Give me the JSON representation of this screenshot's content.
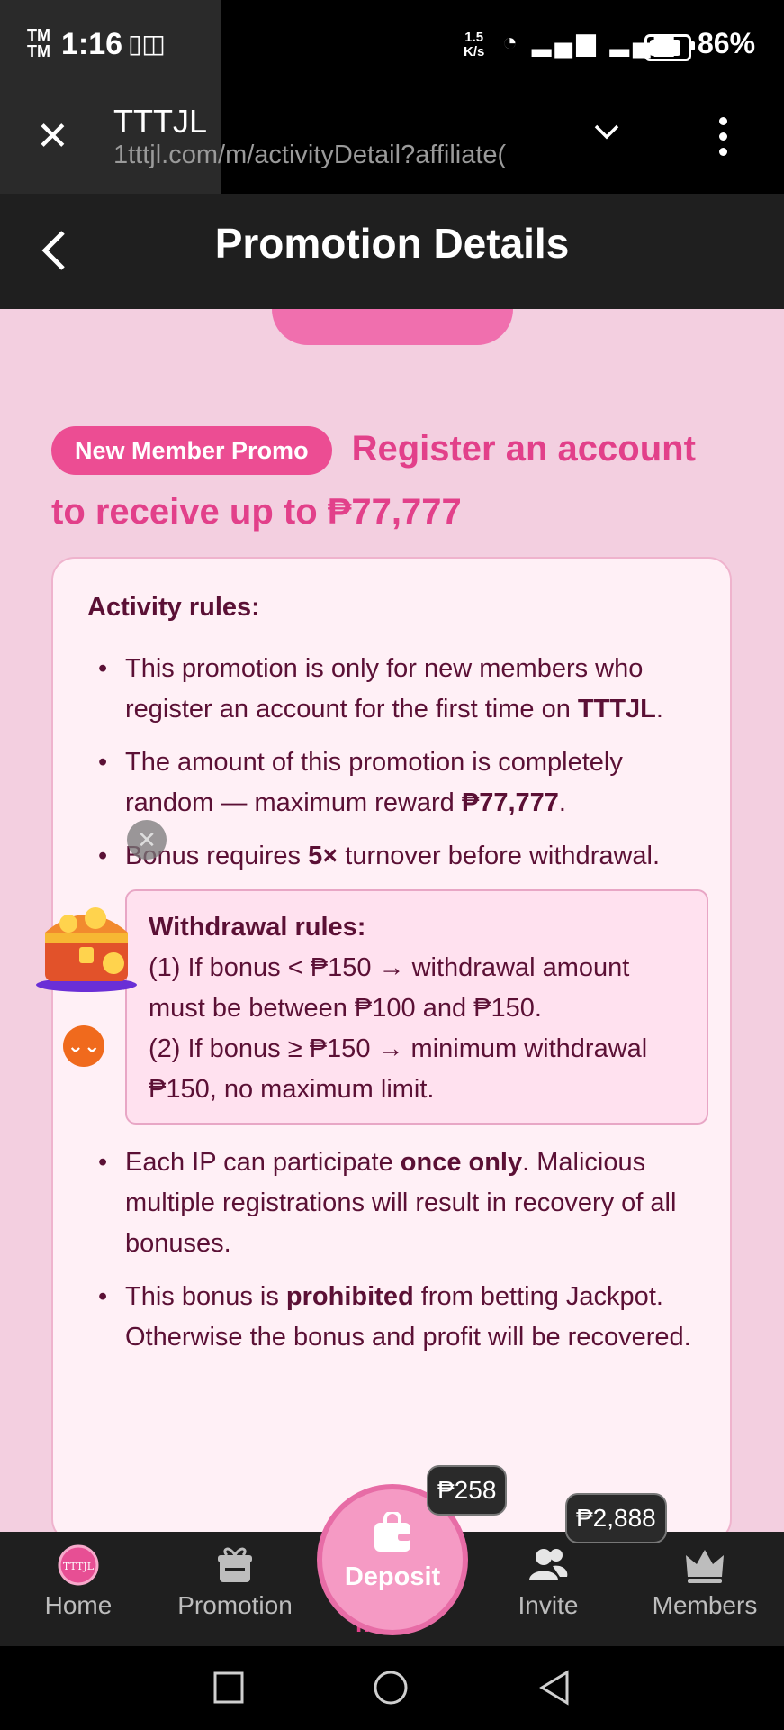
{
  "status_bar": {
    "carrier_mark": "TM\nTM",
    "time": "1:16",
    "net_speed": "1.5\nK/s",
    "battery": "86%"
  },
  "browser": {
    "title": "TTTJL",
    "url": "1tttjl.com/m/activityDetail?affiliate("
  },
  "header": {
    "title": "Promotion Details"
  },
  "promo": {
    "badge": "New Member Promo",
    "headline": "Register an account to receive up to ₱77,777"
  },
  "rules_card": {
    "title": "Activity rules:",
    "rule1": {
      "a": "This promotion is only for new members who register an account for the first time on ",
      "b": "TTTJL",
      "c": "."
    },
    "rule2": {
      "a": "The amount of this promotion is completely random — maximum reward ",
      "b": "₱77,777",
      "c": "."
    },
    "rule3": {
      "a": "Bonus requires ",
      "b": "5×",
      "c": " turnover before withdrawal."
    },
    "withdrawal": {
      "title": "Withdrawal rules:",
      "line1": "(1) If bonus < ₱150 → withdrawal amount must be between ₱100 and ₱150.",
      "line2": "(2) If bonus ≥ ₱150 → minimum withdrawal ₱150, no maximum limit."
    },
    "rule4": {
      "a": "Each IP can participate ",
      "b": "once only",
      "c": ". Malicious multiple registrations will result in recovery of all bonuses."
    },
    "rule5": {
      "a": "This bonus is ",
      "b": "prohibited",
      "c": " from betting Jackpot. Otherwise the bonus and profit will be recovered."
    }
  },
  "bottom_nav": {
    "home": "Home",
    "promotion": "Promotion",
    "deposit": "Deposit",
    "invite": "Invite",
    "members": "Members",
    "deposit_bubble": "₱258",
    "invite_bubble": "₱2,888",
    "ghost_label": "nus"
  },
  "icons": {
    "close": "close-icon",
    "chevron_down": "chevron-down-icon",
    "more": "more-vertical-icon",
    "back": "back-chevron-icon"
  },
  "colors": {
    "accent_pink": "#e2408a",
    "badge_pink": "#ec4d93",
    "text_maroon": "#5b1035",
    "content_bg": "#f3cfe0"
  }
}
